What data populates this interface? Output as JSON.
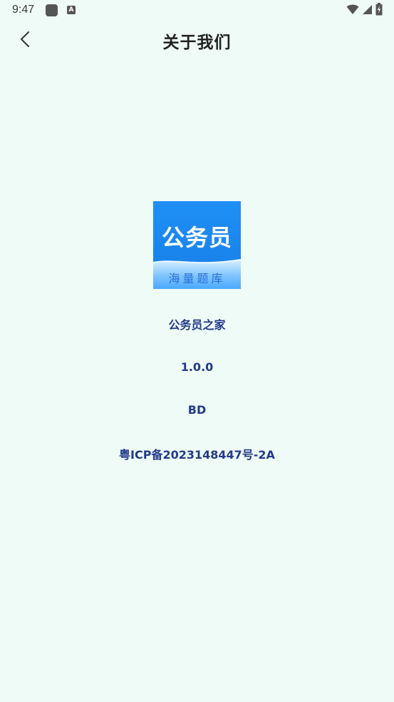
{
  "status_bar": {
    "time": "9:47",
    "a_icon_letter": "A"
  },
  "header": {
    "title": "关于我们"
  },
  "logo": {
    "main_text": "公务员",
    "sub_text": "海量题库"
  },
  "info": {
    "app_name": "公务员之家",
    "version": "1.0.0",
    "channel": "BD",
    "icp": "粤ICP备2023148447号-2A"
  },
  "colors": {
    "background": "#eefbf6",
    "info_text": "#243a8a",
    "logo_blue": "#1a8bf2"
  }
}
